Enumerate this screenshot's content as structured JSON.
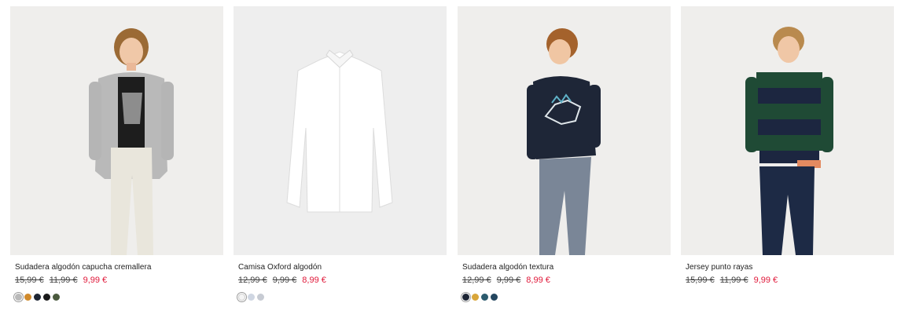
{
  "products": [
    {
      "name": "Sudadera algodón capucha cremallera",
      "prices": [
        "15,99 €",
        "11,99 €",
        "9,99 €"
      ],
      "colors": [
        "#b9b9b9",
        "#d08a2c",
        "#1d2533",
        "#1a1a1a",
        "#4b5a3e"
      ]
    },
    {
      "name": "Camisa Oxford algodón",
      "prices": [
        "12,99 €",
        "9,99 €",
        "8,99 €"
      ],
      "colors": [
        "#f4f4f4",
        "#cfd6e2",
        "#c7cbd3"
      ]
    },
    {
      "name": "Sudadera algodón textura",
      "prices": [
        "12,99 €",
        "9,99 €",
        "8,99 €"
      ],
      "colors": [
        "#1d2535",
        "#d9a63a",
        "#2c5b6e",
        "#24465f"
      ]
    },
    {
      "name": "Jersey punto rayas",
      "prices": [
        "15,99 €",
        "11,99 €",
        "9,99 €"
      ],
      "colors": []
    }
  ]
}
